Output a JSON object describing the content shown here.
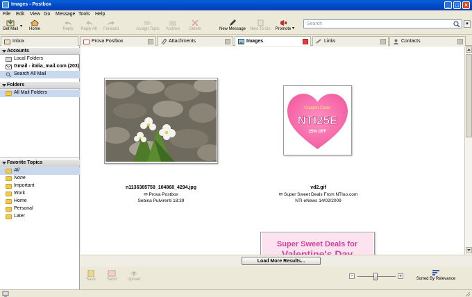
{
  "window": {
    "title": "Images - Postbox"
  },
  "menu": [
    "File",
    "Edit",
    "View",
    "Go",
    "Message",
    "Tools",
    "Help"
  ],
  "toolbar": {
    "get_mail": "Get Mail",
    "home": "Home",
    "reply": "Reply",
    "reply_all": "Reply All",
    "forward": "Forward",
    "assign_topic": "Assign Topic",
    "archive": "Archive",
    "delete": "Delete",
    "new_message": "New Message",
    "new_todo": "New To-Do",
    "promote": "Promote"
  },
  "search": {
    "placeholder": "Search"
  },
  "tabs": [
    {
      "label": "Inbox"
    },
    {
      "label": "Prova Postbox"
    },
    {
      "label": "Attachments"
    },
    {
      "label": "Images"
    },
    {
      "label": "Links"
    },
    {
      "label": "Contacts"
    }
  ],
  "sidebar": {
    "accounts_header": "Accounts",
    "accounts": [
      "Local Folders",
      "Gmail - italia_mail.com (203)",
      "Search All Mail"
    ],
    "folders_header": "Folders",
    "folders": [
      "All Mail Folders"
    ],
    "topics_header": "Favorite Topics",
    "topics": [
      "All",
      "None",
      "Important",
      "Work",
      "Home",
      "Personal",
      "Later"
    ]
  },
  "images": [
    {
      "filename": "n1136385758_104868_4294.jpg",
      "subject": "Prova Postbox",
      "from_date": "Sebina Pulvirenti 18:39"
    },
    {
      "filename": "vd2.gif",
      "subject": "Super Sweet Deals From NTIuo.com",
      "from_date": "NTI eNews 14/02/2009"
    }
  ],
  "coupon": {
    "line1": "Coupon Code:",
    "code": "NTI25E",
    "off": "25% OFF"
  },
  "banner": {
    "line1": "Super Sweet Deals for",
    "line2": "Valentine's Day"
  },
  "load_more": "Load More Results...",
  "bottom": {
    "save": "Save",
    "send": "Send",
    "upload": "Upload",
    "sort": "Sorted By Relevance"
  }
}
